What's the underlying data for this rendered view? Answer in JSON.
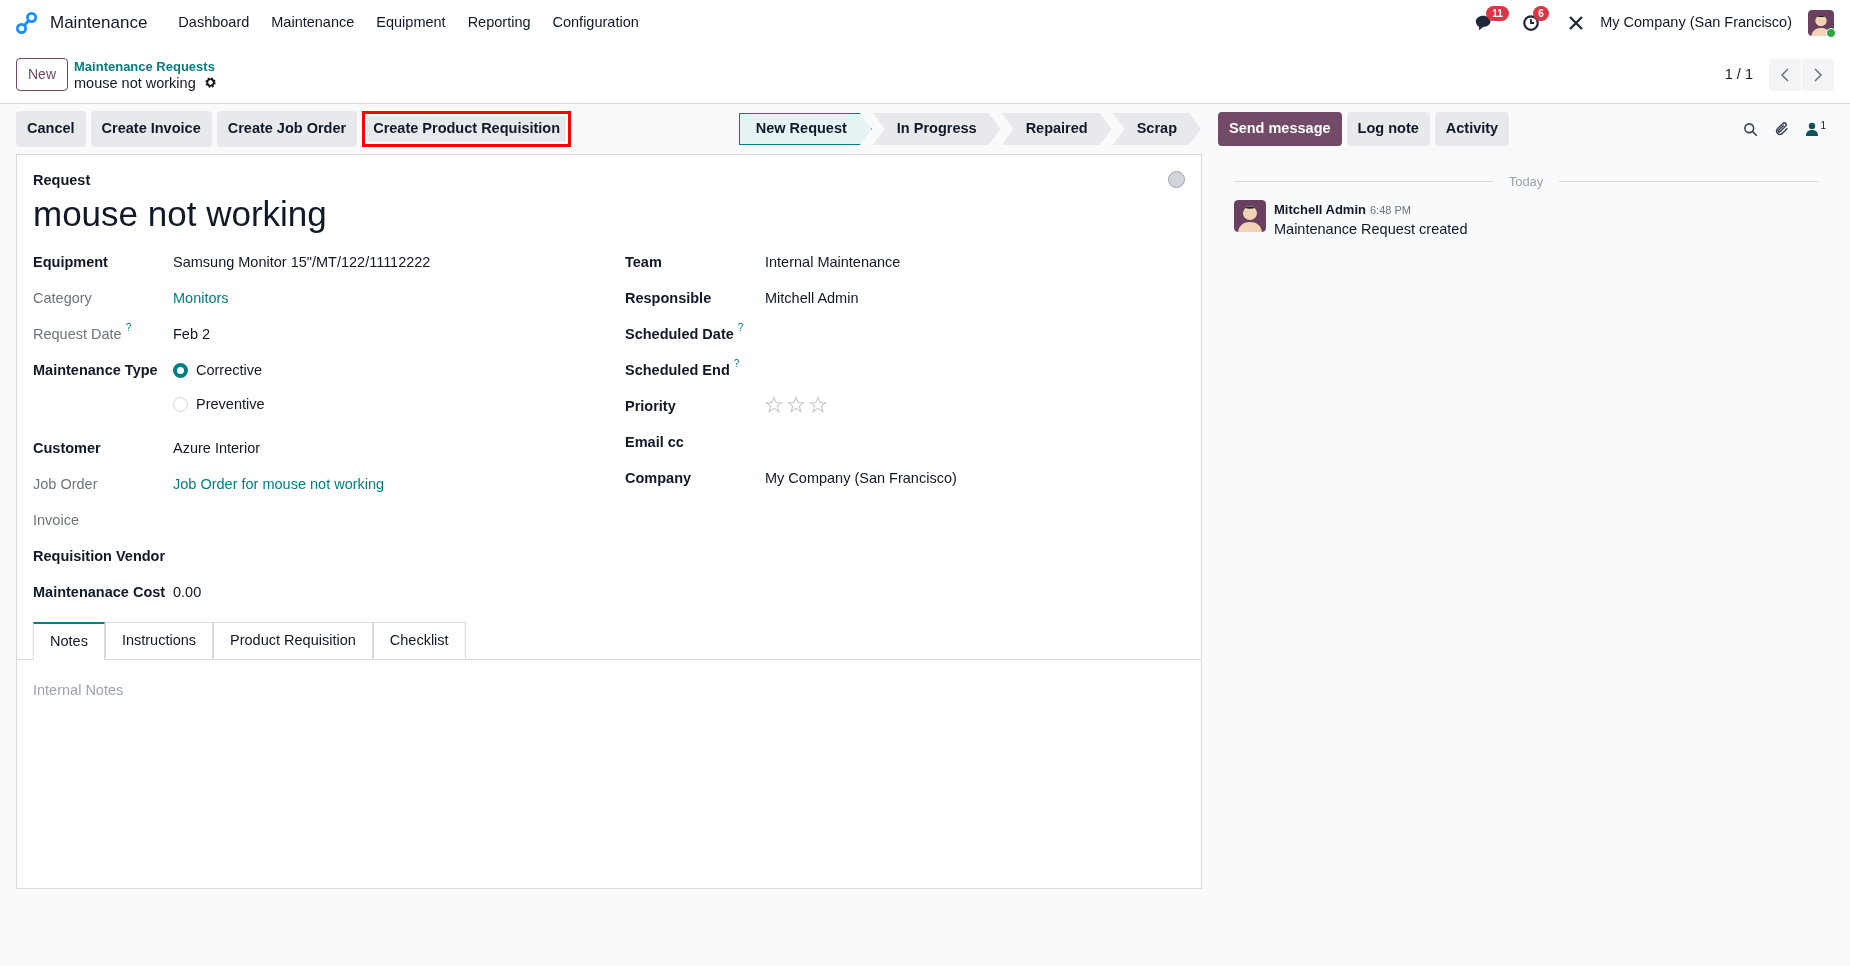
{
  "navbar": {
    "app_name": "Maintenance",
    "menu": [
      "Dashboard",
      "Maintenance",
      "Equipment",
      "Reporting",
      "Configuration"
    ],
    "messages_badge": "11",
    "activities_badge": "6",
    "company": "My Company (San Francisco)"
  },
  "breadcrumb": {
    "new_button": "New",
    "parent": "Maintenance Requests",
    "current": "mouse not working"
  },
  "pager": {
    "text": "1 / 1"
  },
  "actions": [
    {
      "label": "Cancel",
      "highlighted": false
    },
    {
      "label": "Create Invoice",
      "highlighted": false
    },
    {
      "label": "Create Job Order",
      "highlighted": false
    },
    {
      "label": "Create Product Requisition",
      "highlighted": true
    }
  ],
  "stages": [
    {
      "label": "New Request",
      "selected": true
    },
    {
      "label": "In Progress",
      "selected": false
    },
    {
      "label": "Repaired",
      "selected": false
    },
    {
      "label": "Scrap",
      "selected": false
    }
  ],
  "chatter_buttons": [
    {
      "label": "Send message",
      "primary": true
    },
    {
      "label": "Log note",
      "primary": false
    },
    {
      "label": "Activity",
      "primary": false
    }
  ],
  "followers_count": "1",
  "form": {
    "title_label": "Request",
    "title": "mouse not working",
    "left_fields": [
      {
        "kind": "text",
        "label": "Equipment",
        "value": "Samsung Monitor 15\"/MT/122/11112222",
        "readonly": false,
        "link": false
      },
      {
        "kind": "text",
        "label": "Category",
        "value": "Monitors",
        "readonly": true,
        "link": true
      },
      {
        "kind": "text",
        "label": "Request Date",
        "value": "Feb 2",
        "readonly": true,
        "link": false,
        "help": "?"
      },
      {
        "kind": "radio",
        "label": "Maintenance Type",
        "readonly": false,
        "options": [
          {
            "label": "Corrective",
            "selected": true
          },
          {
            "label": "Preventive",
            "selected": false
          }
        ]
      },
      {
        "kind": "text",
        "label": "Customer",
        "value": "Azure Interior",
        "readonly": false,
        "link": false
      },
      {
        "kind": "text",
        "label": "Job Order",
        "value": "Job Order for mouse not working",
        "readonly": true,
        "link": true
      },
      {
        "kind": "text",
        "label": "Invoice",
        "readonly": true
      },
      {
        "kind": "text",
        "label": "Requisition Vendor",
        "readonly": false
      },
      {
        "kind": "text",
        "label": "Maintenanace Cost",
        "value": "0.00",
        "readonly": false,
        "link": false
      }
    ],
    "right_fields": [
      {
        "kind": "text",
        "label": "Team",
        "value": "Internal Maintenance",
        "readonly": false,
        "link": false
      },
      {
        "kind": "text",
        "label": "Responsible",
        "value": "Mitchell Admin",
        "readonly": false,
        "link": false
      },
      {
        "kind": "text",
        "label": "Scheduled Date",
        "readonly": false,
        "help": "?"
      },
      {
        "kind": "text",
        "label": "Scheduled End",
        "readonly": false,
        "help": "?"
      },
      {
        "kind": "stars",
        "label": "Priority",
        "stars": 0,
        "readonly": false
      },
      {
        "kind": "text",
        "label": "Email cc",
        "readonly": false
      },
      {
        "kind": "text",
        "label": "Company",
        "value": "My Company (San Francisco)",
        "readonly": false,
        "link": false
      }
    ],
    "tabs": [
      {
        "label": "Notes",
        "selected": true
      },
      {
        "label": "Instructions",
        "selected": false
      },
      {
        "label": "Product Requisition",
        "selected": false
      },
      {
        "label": "Checklist",
        "selected": false
      }
    ],
    "notes_placeholder": "Internal Notes"
  },
  "chatter": {
    "date_separator": "Today",
    "messages": [
      {
        "author": "Mitchell Admin",
        "time": "6:48 PM",
        "body": "Maintenance Request created"
      }
    ]
  }
}
